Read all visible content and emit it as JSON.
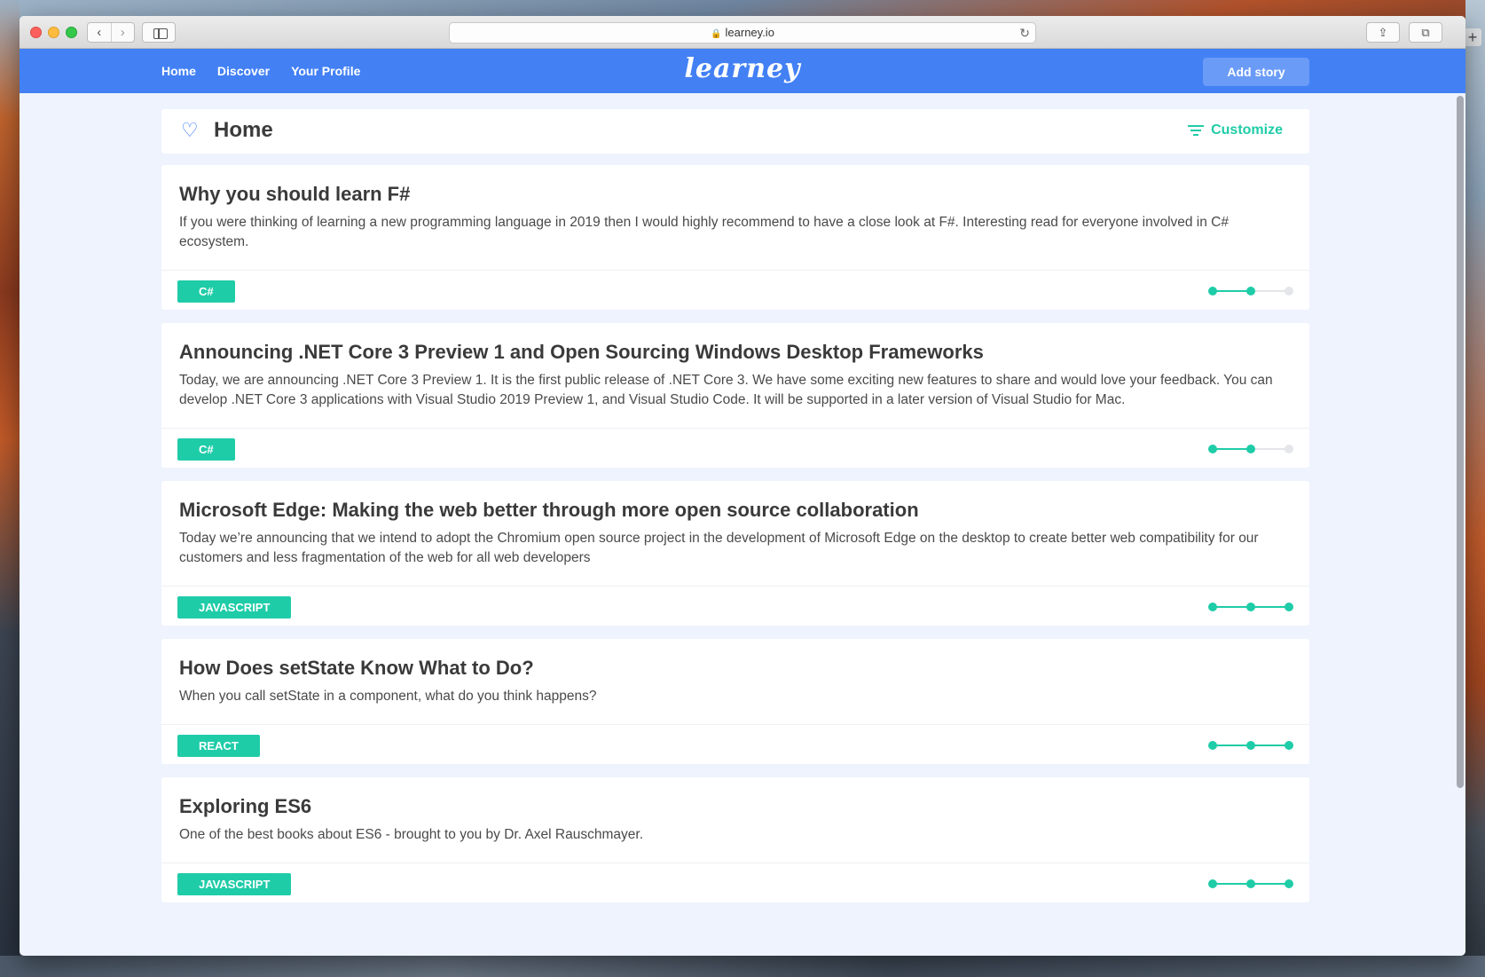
{
  "browser": {
    "url": "learney.io",
    "back_label": "‹",
    "forward_label": "›",
    "reload_label": "↻",
    "share_label": "⇪",
    "tabs_label": "⧉",
    "new_tab_label": "+"
  },
  "app": {
    "logo": "learney",
    "nav": [
      {
        "label": "Home"
      },
      {
        "label": "Discover"
      },
      {
        "label": "Your Profile"
      }
    ],
    "add_story_label": "Add story",
    "accent": "#4280f4",
    "tag_color": "#1fcca8"
  },
  "page": {
    "title": "Home",
    "customize_label": "Customize"
  },
  "stories": [
    {
      "title": "Why you should learn F#",
      "description": "If you were thinking of learning a new programming language in 2019 then I would highly recommend to have a close look at F#. Interesting read for everyone involved in C# ecosystem.",
      "tag": "C#",
      "level": 2,
      "level_max": 3
    },
    {
      "title": "Announcing .NET Core 3 Preview 1 and Open Sourcing Windows Desktop Frameworks",
      "description": "Today, we are announcing .NET Core 3 Preview 1. It is the first public release of .NET Core 3. We have some exciting new features to share and would love your feedback. You can develop .NET Core 3 applications with Visual Studio 2019 Preview 1, and Visual Studio Code. It will be supported in a later version of Visual Studio for Mac.",
      "tag": "C#",
      "level": 2,
      "level_max": 3
    },
    {
      "title": "Microsoft Edge: Making the web better through more open source collaboration",
      "description": "Today we’re announcing that we intend to adopt the Chromium open source project in the development of Microsoft Edge on the desktop to create better web compatibility for our customers and less fragmentation of the web for all web developers",
      "tag": "JAVASCRIPT",
      "level": 3,
      "level_max": 3
    },
    {
      "title": "How Does setState Know What to Do?",
      "description": "When you call setState in a component, what do you think happens?",
      "tag": "REACT",
      "level": 3,
      "level_max": 3
    },
    {
      "title": "Exploring ES6",
      "description": "One of the best books about ES6 - brought to you by Dr. Axel Rauschmayer.",
      "tag": "JAVASCRIPT",
      "level": 3,
      "level_max": 3
    }
  ]
}
